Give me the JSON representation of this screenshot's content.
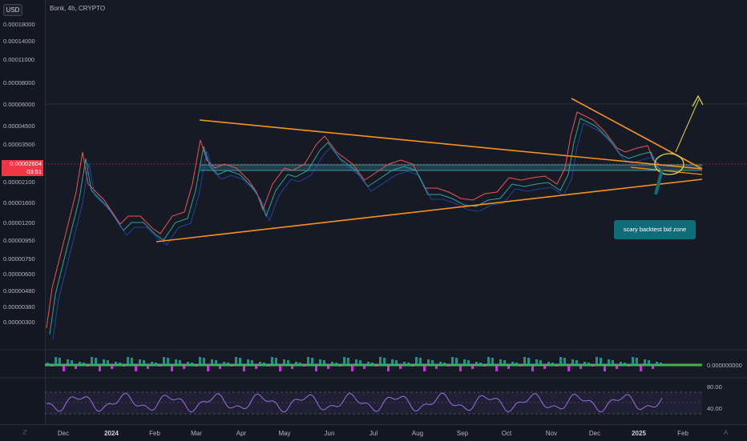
{
  "header": {
    "currency_button": "USD",
    "symbol_title": "Bonk, 4h, CRYPTO"
  },
  "y_axis": {
    "ticks": [
      "0.00018000",
      "0.00014000",
      "0.00011000",
      "0.00008000",
      "0.00006000",
      "0.00004500",
      "0.00003500",
      "0.00002100",
      "0.00001600",
      "0.00001200",
      "0.00000950",
      "0.00000750",
      "0.00000600",
      "0.00000480",
      "0.00000380",
      "0.00000300"
    ],
    "current_price": "0.00002604 5",
    "countdown": "03:51"
  },
  "price_tag": {
    "price": "0.00002604",
    "countdown": "03:51"
  },
  "annotation": {
    "label": "scary backtest bid zone"
  },
  "indicator_pane": {
    "value_label": "0.000000000"
  },
  "rsi_pane": {
    "upper_label": "80.00",
    "lower_label": "40.00"
  },
  "x_axis": {
    "ticks": [
      "Dec",
      "2024",
      "Feb",
      "Mar",
      "Apr",
      "May",
      "Jun",
      "Jul",
      "Aug",
      "Sep",
      "Oct",
      "Nov",
      "Dec",
      "2025",
      "Feb"
    ]
  },
  "colors": {
    "background": "#161a25",
    "trendline": "#f7931a",
    "zone": "#2c8a96",
    "candle_up": "#26a69a",
    "candle_down": "#ef5350",
    "annotation": "#0f6d7a",
    "circle": "#e6d34a",
    "rsi": "#9c6fe0"
  },
  "corner_icons": [
    "zoom-icon",
    "auto-scale-icon"
  ]
}
